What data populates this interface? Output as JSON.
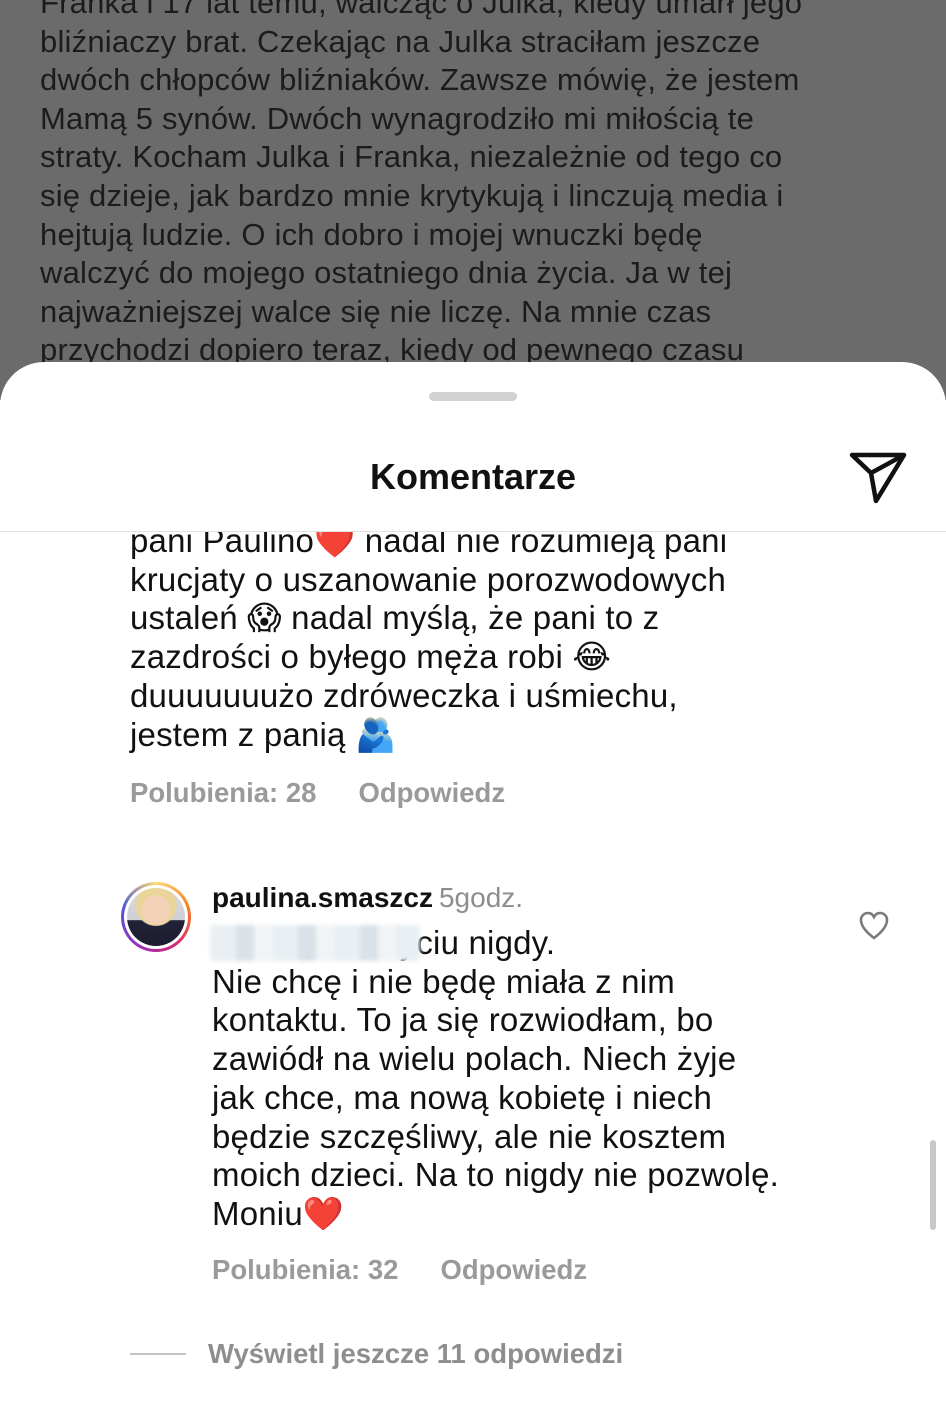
{
  "post": {
    "caption_visible": "Franka i 17 lat temu, walcząc o Julka, kiedy umarł jego\nbliźniaczy brat. Czekając na Julka straciłam jeszcze\ndwóch chłopców bliźniaków. Zawsze mówię, że jestem\nMamą 5 synów. Dwóch wynagrodziło mi miłością te\nstraty. Kocham Julka i Franka, niezależnie od tego co\nsię dzieje, jak bardzo mnie krytykują i linczują media i\nhejtują ludzie. O ich dobro i mojej wnuczki będę\nwalczyć do mojego ostatniego dnia życia. Ja w tej\nnajważniejszej walce się nie liczę. Na mnie czas\nprzychodzi dopiero teraz, kiedy od pewnego czasu"
  },
  "sheet": {
    "title": "Komentarze",
    "share_icon": "paper-plane-icon"
  },
  "comments": [
    {
      "text": "pani Paulino❤️ nadal nie rozumieją pani\nkrucjaty o uszanowanie porozwodowych\nustaleń 😱 nadal myślą, że pani to z\nzazdrości o byłego męża robi 😂\nduuuuuuużo zdróweczka i uśmiechu,\njestem z panią 🫂",
      "likes_label": "Polubienia: 28",
      "reply_label": "Odpowiedz"
    },
    {
      "username": "paulina.smaszcz",
      "time": "5godz.",
      "text": "Moniu, a w życiu nigdy.\nNie chcę i nie będę miała z nim\nkontaktu. To ja  się rozwiodłam, bo\nzawiódł na wielu polach. Niech żyje\njak chce, ma nową kobietę i niech\nbędzie szczęśliwy, ale nie kosztem\nmoich dzieci. Na to nigdy nie pozwolę.\nMoniu❤️",
      "likes_label": "Polubienia: 32",
      "reply_label": "Odpowiedz"
    }
  ],
  "view_more_label": "Wyświetl jeszcze 11 odpowiedzi",
  "colors": {
    "backdrop": "#6b6b6b",
    "muted_text": "#9a9a9a",
    "heart": "#e5202e"
  }
}
